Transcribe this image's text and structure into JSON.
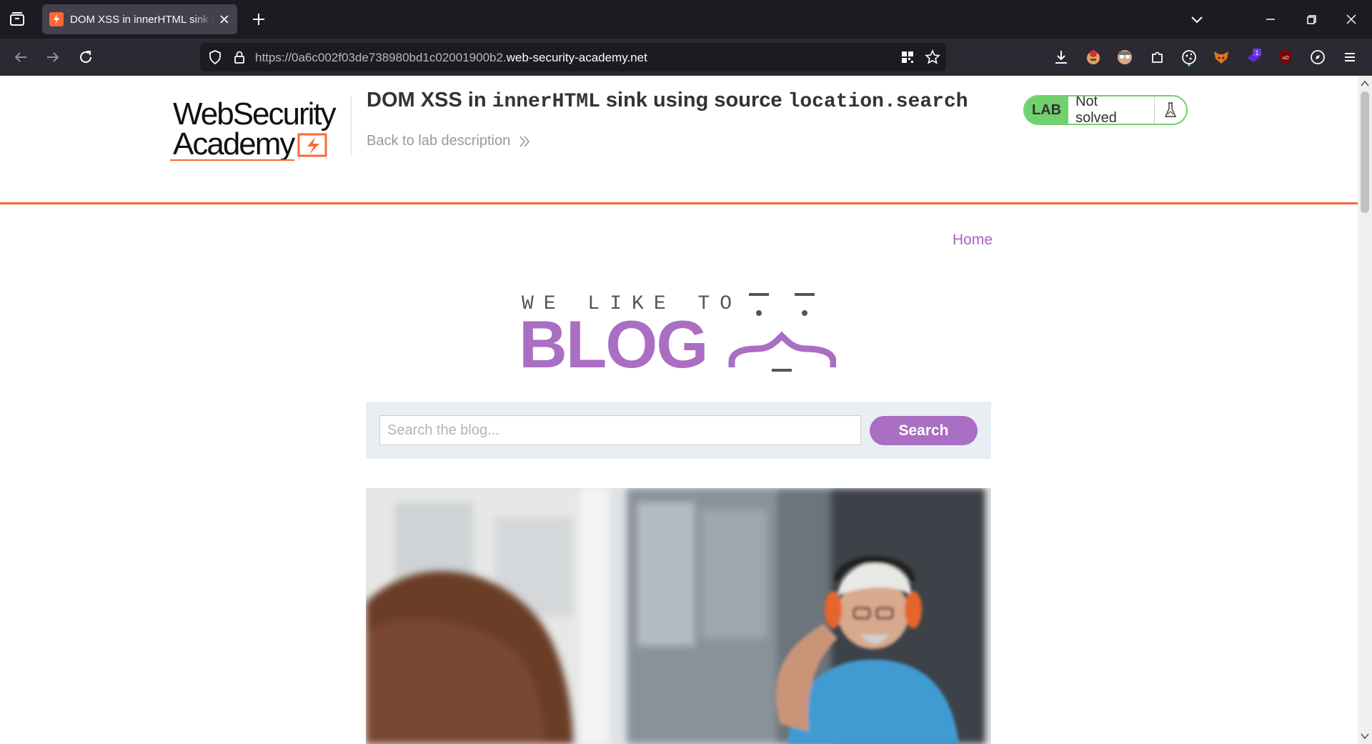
{
  "browser": {
    "tab_title": "DOM XSS in innerHTML sink using source location.search",
    "url_prefix": "https://0a6c002f03de738980bd1c02001900b2.",
    "url_host": "web-security-academy.net",
    "extension_badge_count": "1"
  },
  "academy": {
    "logo_line1": "WebSecurity",
    "logo_line2": "Academy",
    "title_part1": "DOM XSS in ",
    "title_code1": "innerHTML",
    "title_part2": " sink using source ",
    "title_code2": "location.search",
    "back_link": "Back to lab description",
    "status_lab": "LAB",
    "status_text": "Not solved",
    "accent_color": "#ff6633",
    "solved_color": "#70d16d"
  },
  "blog": {
    "home_link": "Home",
    "banner_top": "WE LIKE TO",
    "banner_main": "BLOG",
    "banner_color": "#aa6ec3",
    "search_placeholder": "Search the blog...",
    "search_button": "Search"
  }
}
